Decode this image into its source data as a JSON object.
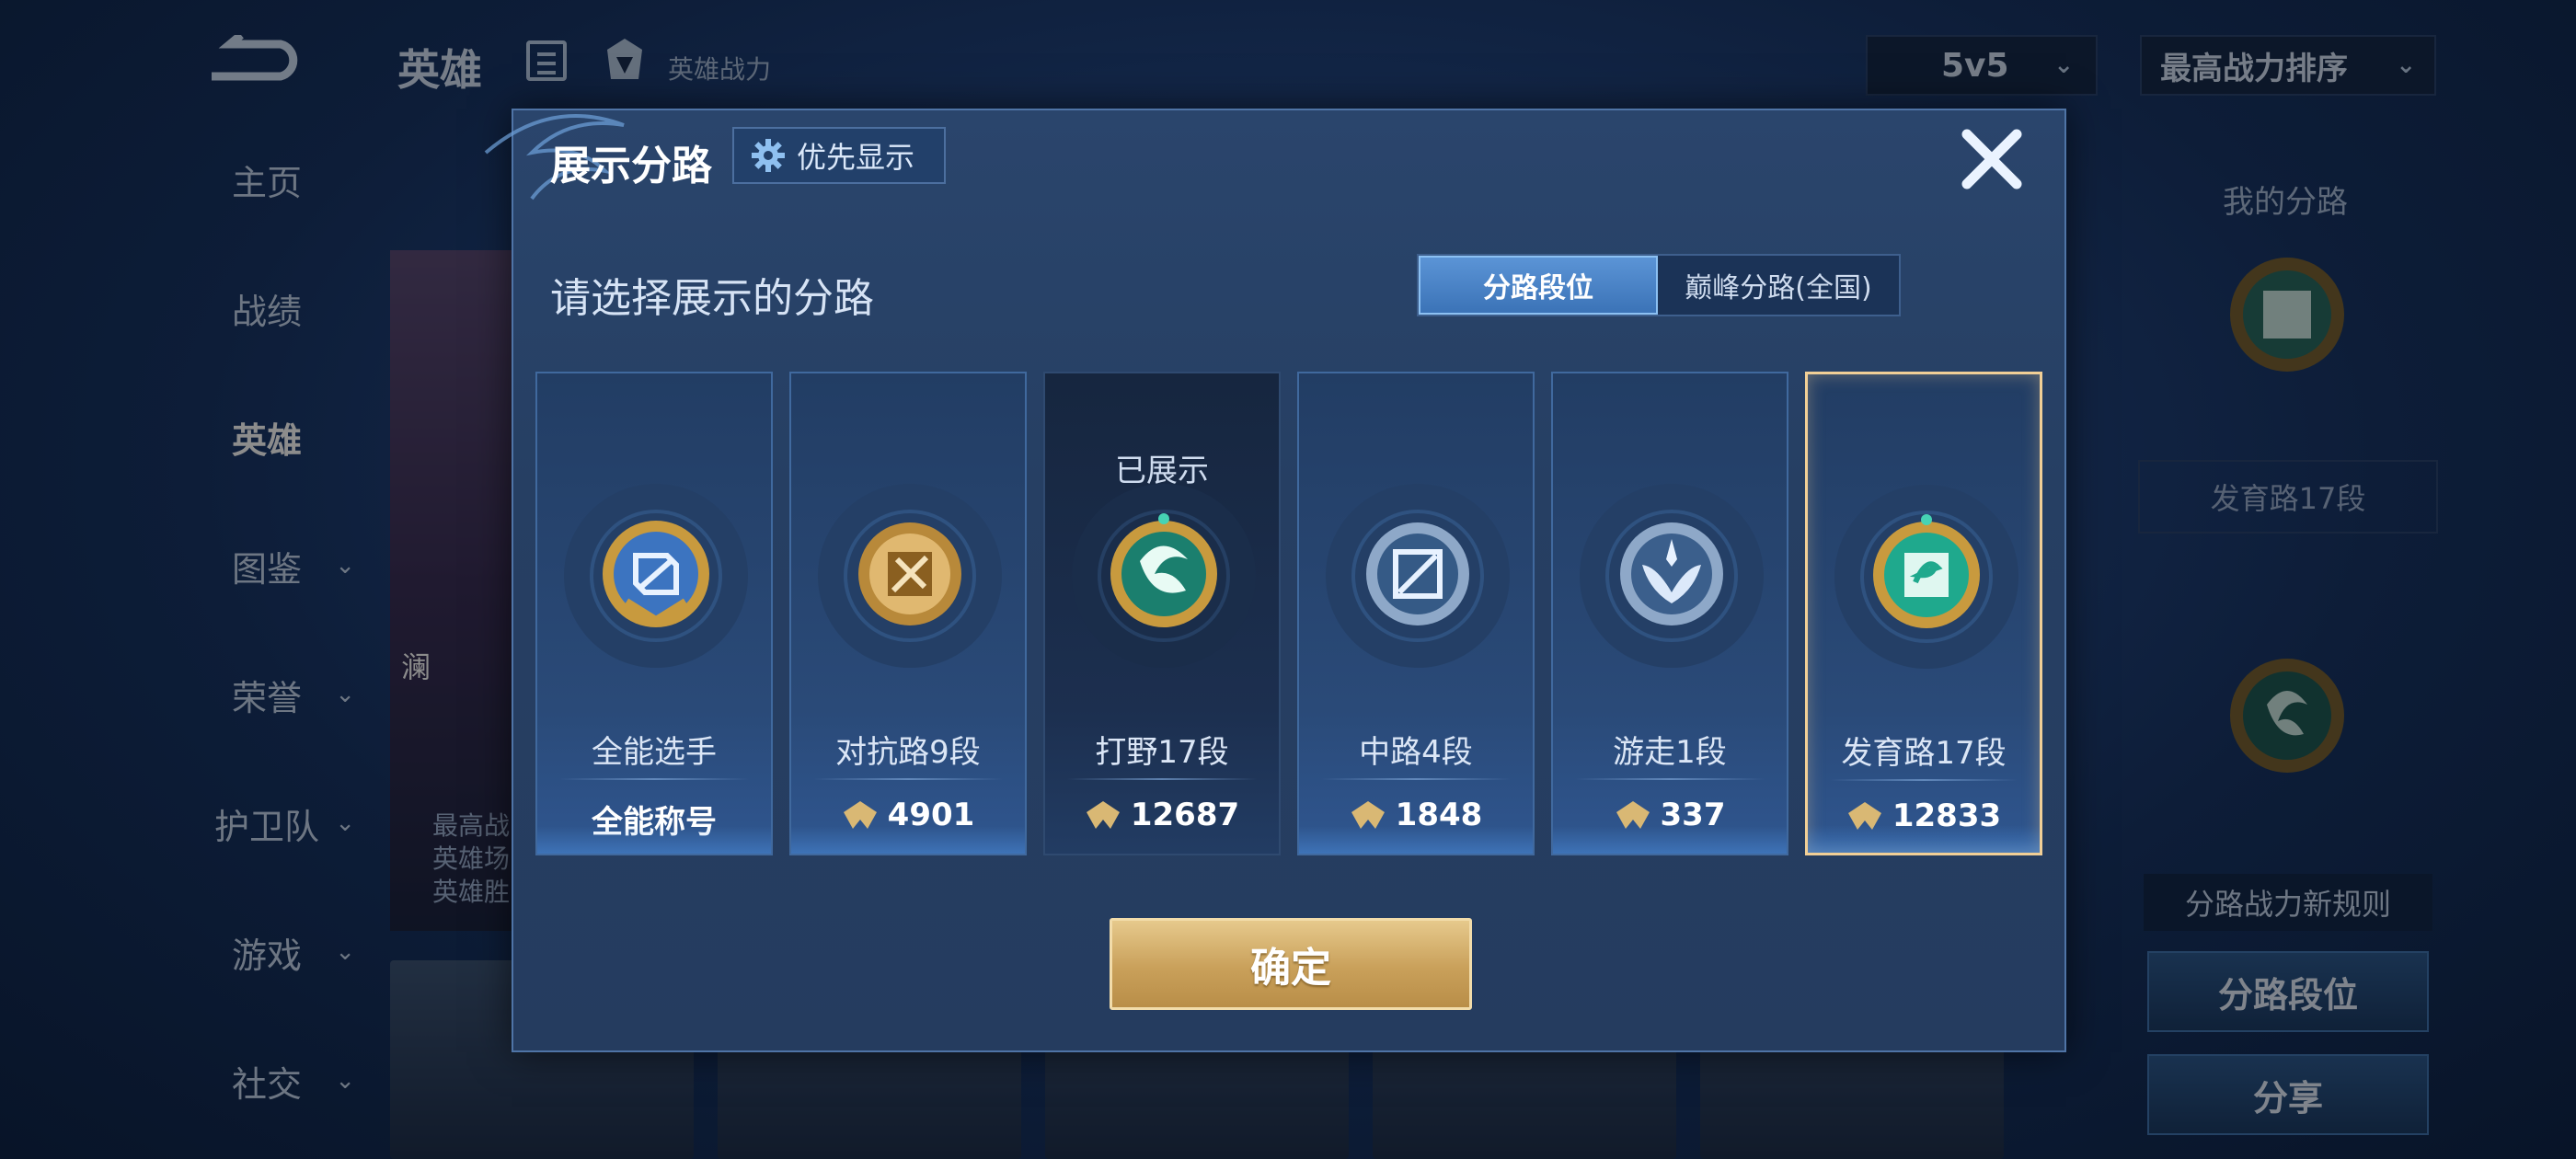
{
  "app": {
    "header": {
      "title": "英雄",
      "power_label": "英雄战力",
      "mode_select": "5v5",
      "sort_select": "最高战力排序"
    },
    "sidebar": [
      {
        "label": "主页",
        "has_arrow": false
      },
      {
        "label": "战绩",
        "has_arrow": false
      },
      {
        "label": "英雄",
        "has_arrow": false,
        "active": true
      },
      {
        "label": "图鉴",
        "has_arrow": true
      },
      {
        "label": "荣誉",
        "has_arrow": true
      },
      {
        "label": "护卫队",
        "has_arrow": true
      },
      {
        "label": "游戏",
        "has_arrow": true
      },
      {
        "label": "社交",
        "has_arrow": true
      }
    ],
    "hero_card": {
      "name": "澜",
      "lines": [
        "最高战",
        "英雄场",
        "英雄胜"
      ]
    },
    "right_panel": {
      "title": "我的分路",
      "rank_label": "发育路17段",
      "rule_label": "分路战力新规则",
      "rank_button": "分路段位",
      "share_button": "分享"
    }
  },
  "modal": {
    "title": "展示分路",
    "priority_button": "优先显示",
    "subtitle": "请选择展示的分路",
    "tabs": [
      "分路段位",
      "巅峰分路(全国)"
    ],
    "active_tab": 0,
    "cards": [
      {
        "name": "全能选手",
        "value": "全能称号",
        "is_title": true,
        "emblem": "allround-emblem-icon",
        "shown": false,
        "selected": false
      },
      {
        "name": "对抗路9段",
        "value": "4901",
        "is_title": false,
        "emblem": "clash-lane-emblem-icon",
        "shown": false,
        "selected": false
      },
      {
        "name": "打野17段",
        "value": "12687",
        "is_title": false,
        "emblem": "jungle-emblem-icon",
        "shown": true,
        "shown_label": "已展示",
        "selected": false
      },
      {
        "name": "中路4段",
        "value": "1848",
        "is_title": false,
        "emblem": "mid-lane-emblem-icon",
        "shown": false,
        "selected": false
      },
      {
        "name": "游走1段",
        "value": "337",
        "is_title": false,
        "emblem": "roam-emblem-icon",
        "shown": false,
        "selected": false
      },
      {
        "name": "发育路17段",
        "value": "12833",
        "is_title": false,
        "emblem": "farm-lane-emblem-icon",
        "shown": false,
        "selected": true
      }
    ],
    "confirm_button": "确定"
  },
  "colors": {
    "accent_gold": "#f1cf96",
    "tab_active": "#4a84c8",
    "card_border": "#40699e"
  }
}
